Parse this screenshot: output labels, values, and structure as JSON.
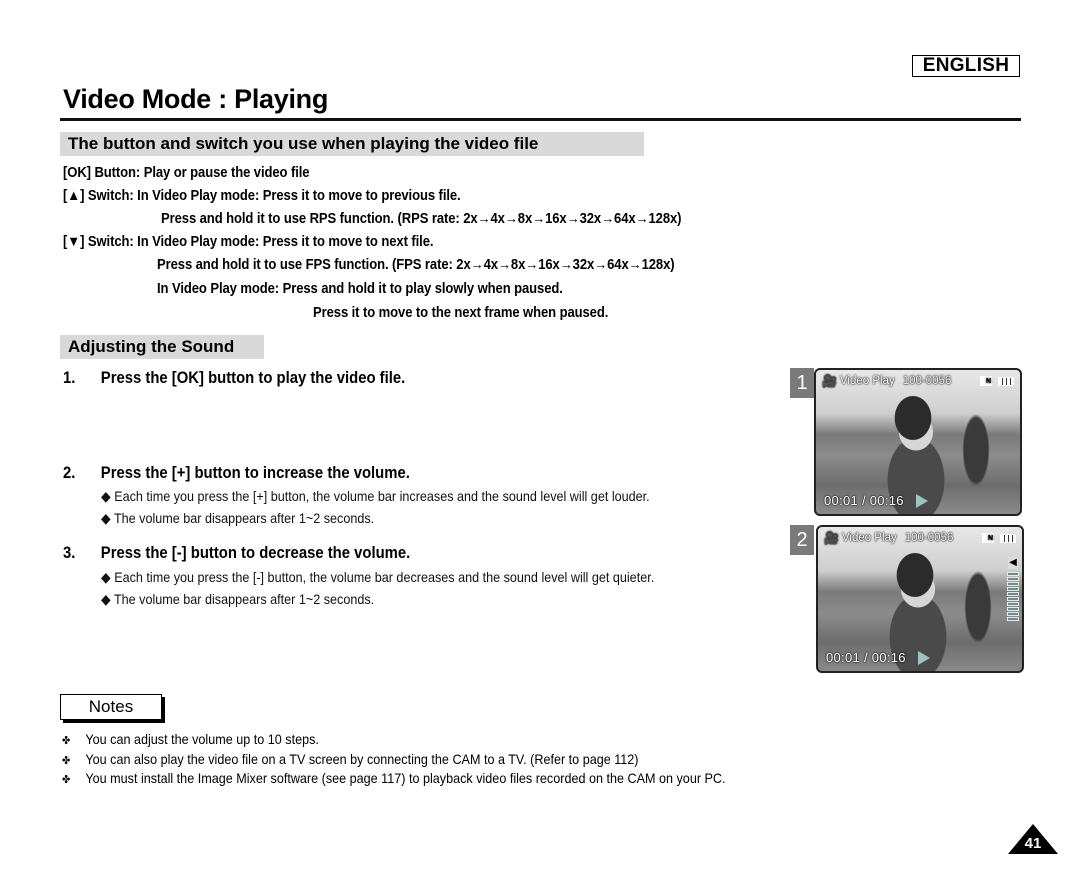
{
  "header": {
    "language": "ENGLISH",
    "title": "Video Mode : Playing"
  },
  "section_buttons": {
    "heading": "The button and switch you use when playing the video file",
    "lines": [
      "[OK] Button: Play or pause the video file",
      "[▲] Switch:  In Video Play mode: Press it to move to previous file.",
      "Press and hold it to use RPS function. (RPS rate: 2x→4x→8x→16x→32x→64x→128x)",
      "[▼] Switch: In Video Play mode: Press it to move to next file.",
      "Press and hold it to use FPS function. (FPS rate: 2x→4x→8x→16x→32x→64x→128x)",
      "In Video Play mode: Press and hold it to play slowly when paused.",
      "Press it to move to the next frame when paused."
    ]
  },
  "section_sound": {
    "heading": "Adjusting the Sound",
    "steps": [
      {
        "number": "1.",
        "text": "Press the [OK] button to play the video file.",
        "bullets": []
      },
      {
        "number": "2.",
        "text": "Press the [+] button to increase the volume.",
        "bullets": [
          "◆ Each time you press the [+] button, the volume bar increases and the sound level will get louder.",
          "◆ The volume bar disappears after 1~2 seconds."
        ]
      },
      {
        "number": "3.",
        "text": "Press the [-] button to decrease the volume.",
        "bullets": [
          "◆ Each time you press the [-] button, the volume bar decreases and the sound level will get quieter.",
          "◆ The volume bar disappears after 1~2 seconds."
        ]
      }
    ]
  },
  "screens": [
    {
      "label": "1",
      "icon": "video-camera-icon",
      "mode": "Video Play",
      "file": "100-0056",
      "quality": "N",
      "time": "00:01 / 00:16",
      "volume_bar_visible": false
    },
    {
      "label": "2",
      "icon": "video-camera-icon",
      "mode": "Video Play",
      "file": "100-0056",
      "quality": "N",
      "time": "00:01 / 00:16",
      "volume_bar_visible": true,
      "volume_steps": 10
    }
  ],
  "notes": {
    "label": "Notes",
    "items": [
      "You can adjust the volume up to 10 steps.",
      "You can also play the video file on a TV screen by connecting the CAM to a TV. (Refer to page 112)",
      "You must install the Image Mixer software (see page 117) to playback video files recorded on  the CAM on your PC."
    ]
  },
  "page_number": "41"
}
